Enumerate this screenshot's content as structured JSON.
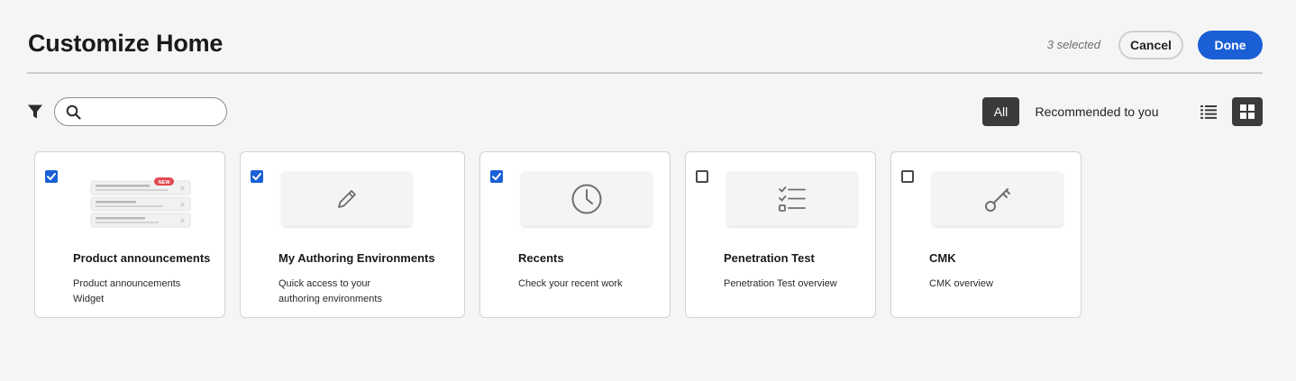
{
  "header": {
    "title": "Customize Home",
    "selected_count": "3 selected",
    "cancel_label": "Cancel",
    "done_label": "Done"
  },
  "toolbar": {
    "filter_icon": "filter-icon",
    "search": {
      "value": "",
      "placeholder": "",
      "icon": "search-icon"
    },
    "tabs": [
      {
        "label": "All",
        "active": true
      },
      {
        "label": "Recommended to you",
        "active": false
      }
    ],
    "views": [
      {
        "icon": "list-view-icon",
        "active": false
      },
      {
        "icon": "grid-view-icon",
        "active": true
      }
    ]
  },
  "cards": [
    {
      "title": "Product announcements",
      "description": "Product announcements Widget",
      "checked": true,
      "icon": "announcements-preview",
      "badge": "NEW"
    },
    {
      "title": "My Authoring Environments",
      "description": "Quick access to your authoring environments",
      "checked": true,
      "icon": "pencil-icon"
    },
    {
      "title": "Recents",
      "description": "Check your recent work",
      "checked": true,
      "icon": "clock-icon"
    },
    {
      "title": "Penetration Test",
      "description": "Penetration Test overview",
      "checked": false,
      "icon": "checklist-icon"
    },
    {
      "title": "CMK",
      "description": "CMK overview",
      "checked": false,
      "icon": "key-icon"
    }
  ],
  "colors": {
    "accent": "#1a5fd6",
    "background": "#f5f5f5",
    "selected_tab": "#3b3b3b",
    "badge": "#e34850"
  }
}
